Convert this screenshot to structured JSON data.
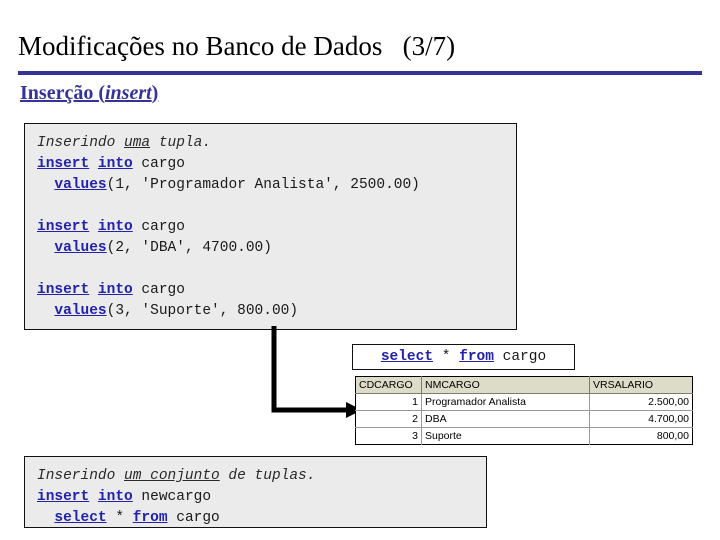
{
  "slide": {
    "title": "Modificações no Banco de Dados   (3/7)",
    "section_heading_main": "Inserção (",
    "section_heading_italic": "insert",
    "section_heading_end": ")",
    "rule_color": "#333399",
    "keyword_color": "#2222aa",
    "code_bg": "#ebebeb",
    "table_header_bg": "#dcdcc8"
  },
  "code_insert_rows": {
    "comment_prefix": "Inserindo ",
    "comment_underlined": "uma",
    "comment_suffix": " tupla.",
    "statements": [
      {
        "kw_insert": "insert",
        "kw_into": "into",
        "table": " cargo",
        "kw_values": "values",
        "args": "(1, 'Programador Analista', 2500.00)"
      },
      {
        "kw_insert": "insert",
        "kw_into": "into",
        "table": " cargo",
        "kw_values": "values",
        "args": "(2, 'DBA', 4700.00)"
      },
      {
        "kw_insert": "insert",
        "kw_into": "into",
        "table": " cargo",
        "kw_values": "values",
        "args": "(3, 'Suporte', 800.00)"
      }
    ]
  },
  "select_box": {
    "kw_select": "select",
    "star": " * ",
    "kw_from": "from",
    "table": " cargo"
  },
  "result_table": {
    "columns": [
      "CDCARGO",
      "NMCARGO",
      "VRSALARIO"
    ],
    "rows": [
      {
        "cdcargo": "1",
        "nmcargo": "Programador Analista",
        "vrsalario": "2.500,00"
      },
      {
        "cdcargo": "2",
        "nmcargo": "DBA",
        "vrsalario": "4.700,00"
      },
      {
        "cdcargo": "3",
        "nmcargo": "Suporte",
        "vrsalario": "800,00"
      }
    ]
  },
  "code_insert_select": {
    "comment_prefix": "Inserindo ",
    "comment_underlined": "um conjunto",
    "comment_suffix": " de tuplas.",
    "kw_insert": "insert",
    "kw_into": "into",
    "target_table": " newcargo",
    "kw_select": "select",
    "star": " * ",
    "kw_from": "from",
    "source_table": " cargo"
  }
}
